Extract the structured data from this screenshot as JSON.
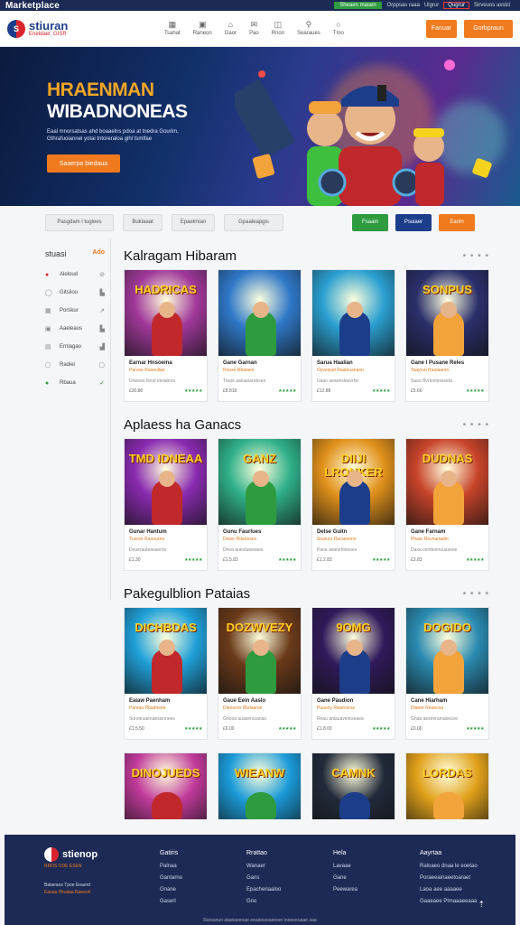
{
  "topbar": {
    "title": "Marketplace",
    "green_label": "Sheaen masen",
    "links": [
      "Orppsas raaa",
      "Ulgrur"
    ],
    "red_label": "Qugrur",
    "right_link": "Sirveuos axslcl"
  },
  "header": {
    "logo_line1": "stiuran",
    "logo_line2": "Eneldaer, GISR",
    "nav": [
      {
        "icon": "grid-icon",
        "glyph": "▦",
        "label": "Tsahat"
      },
      {
        "icon": "gift-icon",
        "glyph": "▣",
        "label": "Raneon"
      },
      {
        "icon": "bag-icon",
        "glyph": "⌂",
        "label": "Gaor"
      },
      {
        "icon": "mail-icon",
        "glyph": "✉",
        "label": "Pao"
      },
      {
        "icon": "tag-icon",
        "glyph": "◫",
        "label": "Rnon"
      },
      {
        "icon": "search-icon",
        "glyph": "⚲",
        "label": "Searaues"
      },
      {
        "icon": "user-icon",
        "glyph": "○",
        "label": "Tmo"
      }
    ],
    "btn1": "Fanuar",
    "btn2": "Gorbpraun"
  },
  "hero": {
    "title1": "HRAENMAN",
    "title2": "WIBADNONEAS",
    "subtitle": "Eaal mnorsatsas ahd boaaelns pdoa at tnedra Gourim, Gthrafuoiannel yotai tntoreraloa gihl tsmlfae",
    "cta": "Saaerpa biedaua"
  },
  "filters": {
    "chips": [
      "Pasgdam l tugiees",
      "Buklaaat",
      "Epaelmian",
      "Gpaaleapgis"
    ],
    "buttons": [
      "Fsaain",
      "Psuiaer",
      "Eaoln"
    ]
  },
  "sidebar": {
    "title": "stuasi",
    "add_label": "Ado",
    "items": [
      {
        "icon": "fire-icon",
        "glyph": "●",
        "label": "Aleloud",
        "right": "⊘"
      },
      {
        "icon": "clock-icon",
        "glyph": "◯",
        "label": "Gitsiiou",
        "right": "▙"
      },
      {
        "icon": "image-icon",
        "glyph": "▦",
        "label": "Porskur",
        "right": "↗"
      },
      {
        "icon": "gallery-icon",
        "glyph": "▣",
        "label": "Aaeleaus",
        "right": "▙"
      },
      {
        "icon": "folder-icon",
        "glyph": "▤",
        "label": "Ernlagao",
        "right": "▟"
      },
      {
        "icon": "doc-icon",
        "glyph": "▢",
        "label": "Radiei",
        "right": "▢"
      },
      {
        "icon": "check-icon",
        "glyph": "●",
        "label": "Rbaua",
        "right": "✓"
      }
    ]
  },
  "sections": [
    {
      "title": "Kalragam Hibaram",
      "cards": [
        {
          "art": "HADRICAS",
          "title": "Earnar Hnsoeina",
          "sub": "Parcee Raxeuliae",
          "desc": "Uneeeo fsnol etvlabres",
          "price": "£30.80",
          "stars": "★★★★★"
        },
        {
          "art": "",
          "title": "Gane Garnan",
          "sub": "Rouxe Rbalaeo",
          "desc": "Trepe aaluaoarebsen",
          "price": "£8.818",
          "stars": "★★★★★"
        },
        {
          "art": "",
          "title": "Sarua Haalian",
          "sub": "Oyvelyad Raalouanasn",
          "desc": "Uaao aeaonsleevrhe",
          "price": "£12.88",
          "stars": "★★★★★"
        },
        {
          "art": "SONPUS",
          "title": "Gane I Pusane Reles",
          "sub": "Taayrun Raulaanrn",
          "desc": "Saoo Bvrlomessseta",
          "price": "£5.66",
          "stars": "★★★★★"
        }
      ]
    },
    {
      "title": "Aplaess ha Ganacs",
      "cards": [
        {
          "art": "TMD IDNEAA",
          "title": "Gunar Hantum",
          "sub": "Tuuree Raneurea",
          "desc": "Deuerauteasaeros",
          "price": "£1.30",
          "stars": "★★★★★"
        },
        {
          "art": "GANZ",
          "title": "Gunu Faurlues",
          "sub": "Deiee Rdaneses",
          "desc": "Dnoa aueulueesaes",
          "price": "£1.5.82",
          "stars": "★★★★★"
        },
        {
          "art": "DIIJI LRONKER",
          "title": "Delse Guitn",
          "sub": "Ssaruor Ruraeeeno",
          "desc": "Paoa asanehionoes",
          "price": "£1.2.83",
          "stars": "★★★★★"
        },
        {
          "art": "DUDNAS",
          "title": "Gane Farnam",
          "sub": "Phaar Rovnaraatin",
          "desc": "Daxa cemteinruuaseee",
          "price": "£3.83",
          "stars": "★★★★★"
        }
      ]
    },
    {
      "title": "Pakegulblion Pataias",
      "cards": [
        {
          "art": "DICHBDAS",
          "title": "Eaiaw Paenham",
          "sub": "Panrau Rbadneee",
          "desc": "Sonoeuaenaessionees",
          "price": "£1.5.50",
          "stars": "★★★★★"
        },
        {
          "art": "DOZWVEZY",
          "title": "Gaue Eein Aaslo",
          "sub": "Dleearoo Rbrlaarse",
          "desc": "Gnooa auaserocanas",
          "price": "£6.00",
          "stars": "★★★★★"
        },
        {
          "art": "9OMG",
          "title": "Gane Paudion",
          "sub": "Puuooy Rwarcerse",
          "desc": "Reau anlauavereseaea",
          "price": "£1.8.00",
          "stars": "★★★★★"
        },
        {
          "art": "DOGIDO",
          "title": "Cane Hiarham",
          "sub": "Dlaeer Reuecoa",
          "desc": "Gnaa aeseeramaseuve",
          "price": "£0.00",
          "stars": "★★★★★"
        }
      ]
    }
  ],
  "row4": [
    {
      "art": "DINOJUEDS"
    },
    {
      "art": "WIEANW"
    },
    {
      "art": "CAMNK"
    },
    {
      "art": "LORDAS"
    }
  ],
  "footer": {
    "brand": "stienop",
    "tagline": "RRDS ODE ESEN",
    "copy": [
      "Balaeaos Tpoe Eeaerd",
      "Eaoaa Plnalaa Raeeoh"
    ],
    "cols": [
      {
        "head": "Gatiris",
        "items": [
          "Palnaa",
          "Gantarno",
          "Gnane",
          "Gaserl"
        ]
      },
      {
        "head": "Rrattao",
        "items": [
          "Wanaer",
          "Gans",
          "Epacheriaaloo",
          "Gno"
        ]
      },
      {
        "head": "Hela",
        "items": [
          "Lavaae",
          "Gane",
          "Peewarea"
        ]
      },
      {
        "head": "Aayrtaa",
        "items": [
          "Raloaeo dnaa le eoetao",
          "Poraeeainaeetoaraet",
          "Laoa aee aaaaee",
          "Gaaeaee Plmaaaeeaaa"
        ]
      }
    ],
    "bottom": "Rarsanun ataeiaeeoae eeaieeaoaeoeer ineeeeuaae oaa"
  }
}
